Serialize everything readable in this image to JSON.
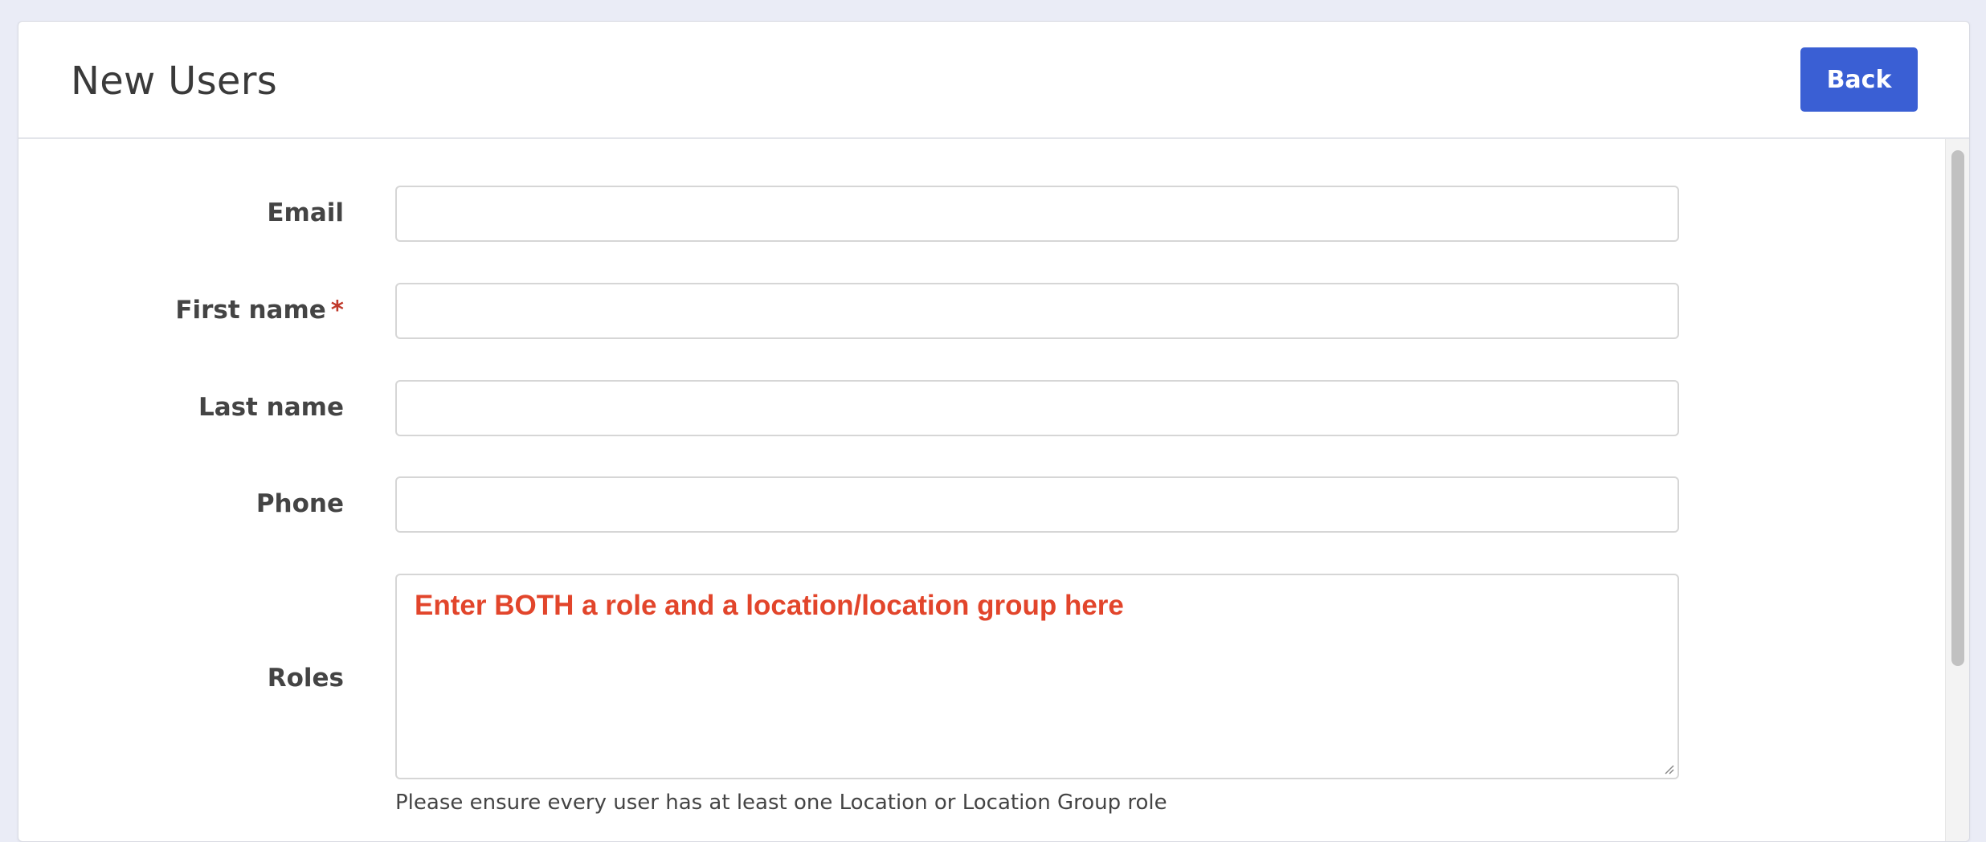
{
  "header": {
    "title": "New Users",
    "back_label": "Back"
  },
  "form": {
    "email": {
      "label": "Email",
      "value": "",
      "placeholder": ""
    },
    "first_name": {
      "label": "First name",
      "required_mark": "*",
      "value": "",
      "placeholder": ""
    },
    "last_name": {
      "label": "Last name",
      "value": "",
      "placeholder": ""
    },
    "phone": {
      "label": "Phone",
      "value": "",
      "placeholder": ""
    },
    "roles": {
      "label": "Roles",
      "hint": "Enter BOTH a role and a location/location group here",
      "help_text": "Please ensure every user has at least one Location or Location Group role"
    }
  },
  "colors": {
    "page_background": "#eaecf6",
    "primary_button": "#3a5fd4",
    "required": "#c0392b",
    "hint_text": "#e2452b",
    "label_text": "#444444"
  }
}
